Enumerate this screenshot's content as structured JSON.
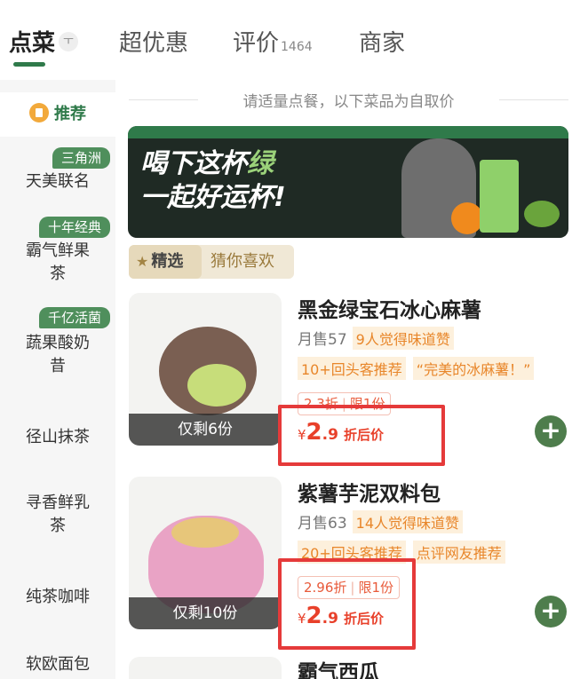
{
  "tabs": [
    {
      "label": "点菜",
      "active": true
    },
    {
      "label": "超优惠"
    },
    {
      "label": "评价",
      "count": "1464"
    },
    {
      "label": "商家"
    }
  ],
  "tab_icon": "text-mode-icon",
  "sidebar": [
    {
      "label": "推荐",
      "active": true,
      "icon": "recommend-icon"
    },
    {
      "label": "天美联名",
      "badge": "三角洲"
    },
    {
      "label": "霸气鲜果茶",
      "badge": "十年经典"
    },
    {
      "label": "蔬果酸奶昔",
      "badge": "千亿活菌"
    },
    {
      "label": "径山抹茶"
    },
    {
      "label": "寻香鲜乳茶"
    },
    {
      "label": "纯茶咖啡"
    },
    {
      "label": "软欧面包"
    }
  ],
  "notice": "请适量点餐，以下菜品为自取价",
  "banner": {
    "line1": "喝下这杯",
    "line1_green": "绿",
    "line2": "一起好运杯!"
  },
  "filter": {
    "selected": "精选",
    "other": "猜你喜欢"
  },
  "items": [
    {
      "name": "黑金绿宝石冰心麻薯",
      "sales": "月售57",
      "praise": "9人觉得味道赞",
      "tags": [
        "10+回头客推荐",
        "“完美的冰麻薯！”"
      ],
      "discount": "2.3折",
      "limit": "限1份",
      "price_currency": "¥",
      "price_int": "2",
      "price_dec": ".9",
      "price_label": "折后价",
      "remaining": "仅剩6份"
    },
    {
      "name": "紫薯芋泥双料包",
      "sales": "月售63",
      "praise": "14人觉得味道赞",
      "tags": [
        "20+回头客推荐",
        "点评网友推荐"
      ],
      "discount": "2.96折",
      "limit": "限1份",
      "price_currency": "¥",
      "price_int": "2",
      "price_dec": ".9",
      "price_label": "折后价",
      "remaining": "仅剩10份"
    },
    {
      "name": "霸气西瓜"
    }
  ],
  "colors": {
    "accent": "#2f7a4a",
    "price": "#e8402a",
    "highlight": "#e53a3a"
  }
}
